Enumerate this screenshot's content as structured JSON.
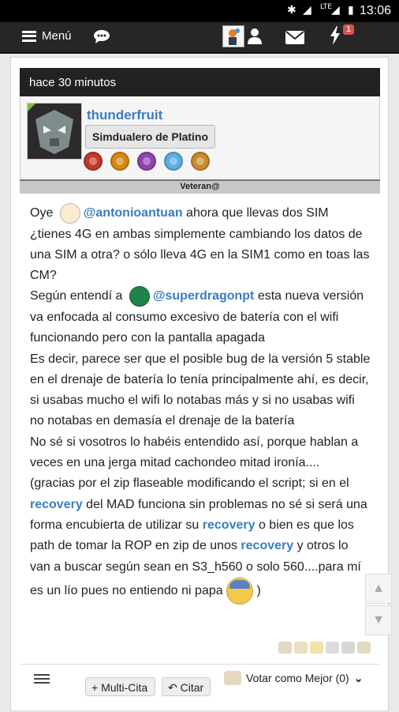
{
  "statusbar": {
    "time": "13:06",
    "network": "LTE"
  },
  "navbar": {
    "menu_label": "Menú",
    "notifications_count": "1"
  },
  "post": {
    "time_ago": "hace 30 minutos",
    "author": {
      "username": "thunderfruit",
      "rank": "Simdualero de Platino",
      "title_bar": "Veteran@"
    },
    "medals": [
      "#c0392b",
      "#d68910",
      "#8e44ad",
      "#5dade2",
      "#ca8a2e"
    ],
    "content": {
      "p1_pre": "Oye ",
      "mention1": "@antonioantuan",
      "p1_post": " ahora que llevas dos SIM ¿tienes 4G en ambas simplemente cambiando los datos de una SIM a otra? o sólo lleva 4G en la SIM1 como en toas las CM?",
      "p2_pre": "Según entendí a ",
      "mention2": "@superdragonpt",
      "p2_post": " esta nueva versión va enfocada al consumo excesivo de batería con el wifi funcionando pero con la pantalla apagada",
      "p3": "Es decir, parece ser que el posible bug de la versión 5 stable en el drenaje de batería lo tenía principalmente ahí, es decir, si usabas mucho el wifi lo notabas más y si no usabas wifi no notabas en demasía el drenaje de la batería",
      "p4": "No sé si vosotros lo habéis entendido así, porque hablan a veces en una jerga mitad cachondeo mitad ironía....",
      "p5_a": "(gracias por el zip flaseable modificando el script; si en el ",
      "link1": "recovery",
      "p5_b": " del MAD funciona sin problemas no sé si será una forma encubierta de utilizar su ",
      "link2": "recovery",
      "p5_c": " o bien es que los path de tomar la ROP en zip de unos ",
      "link3": "recovery",
      "p5_d": " y otros lo van a buscar según sean en S3_h560 o solo 560....para mí es un lío pues no entiendo ni papa ",
      "p5_end": ")"
    }
  },
  "footer": {
    "multi_cita": "+ Multi-Cita",
    "citar": "Citar",
    "vote": "Votar como Mejor (0)"
  },
  "colors": {
    "accent": "#3a7cc0",
    "header": "#222222",
    "badge": "#d9534f"
  }
}
